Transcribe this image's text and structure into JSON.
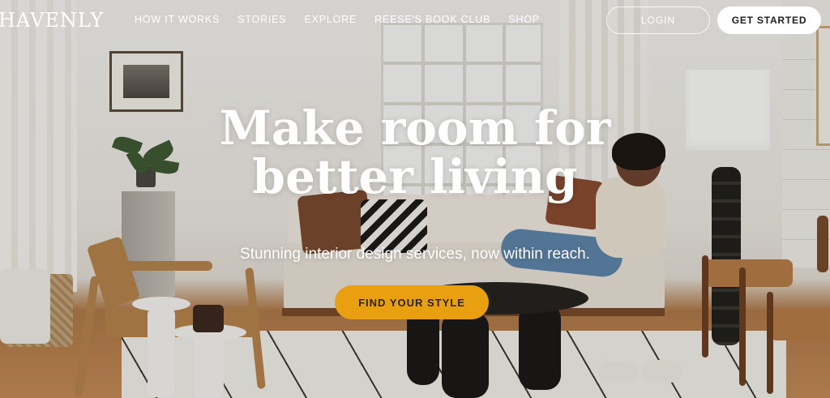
{
  "brand": {
    "logo": "HAVENLY"
  },
  "nav": {
    "items": [
      {
        "label": "HOW IT WORKS"
      },
      {
        "label": "STORIES"
      },
      {
        "label": "EXPLORE"
      },
      {
        "label": "REESE'S BOOK CLUB"
      },
      {
        "label": "SHOP"
      }
    ],
    "login_label": "LOGIN",
    "get_started_label": "GET STARTED"
  },
  "hero": {
    "headline_line1": "Make room for",
    "headline_line2": "better living",
    "subheadline": "Stunning interior design services, now within reach.",
    "cta_label": "FIND YOUR STYLE"
  },
  "colors": {
    "cta_background": "#e8a010",
    "text_on_image": "#ffffff",
    "primary_button_bg": "#ffffff"
  }
}
